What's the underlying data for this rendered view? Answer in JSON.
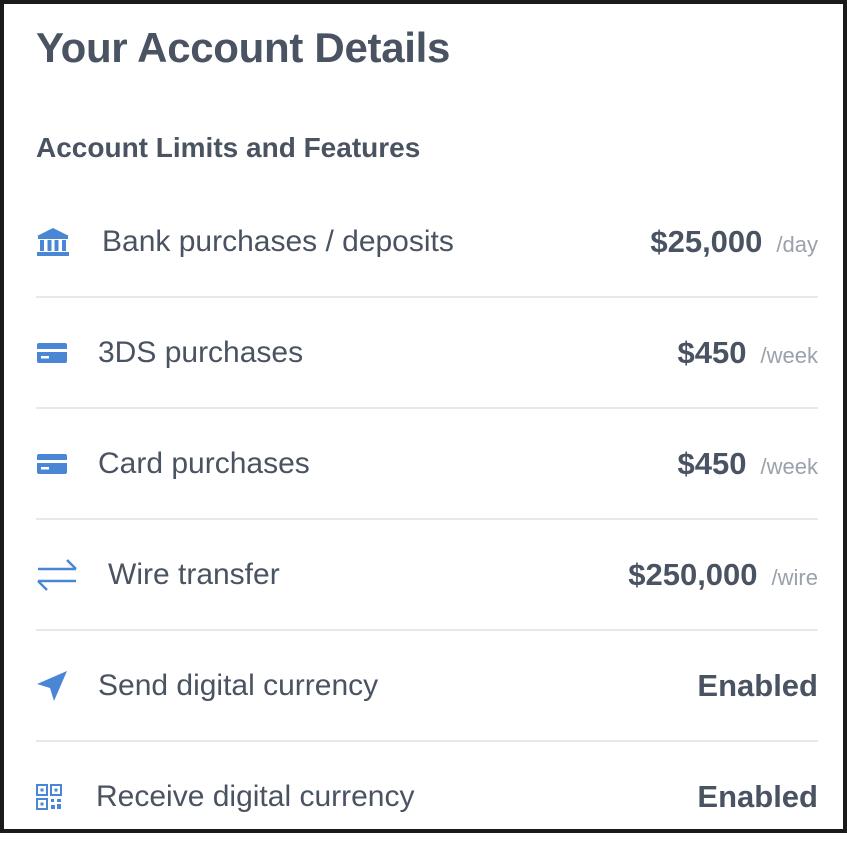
{
  "header": {
    "title": "Your Account Details",
    "section_title": "Account Limits and Features"
  },
  "colors": {
    "icon_blue": "#4a86d6",
    "text_dark": "#4a5362",
    "text_muted": "#9aa1ab",
    "divider": "#e6e8ec"
  },
  "limits": [
    {
      "icon": "bank-icon",
      "label": "Bank purchases / deposits",
      "amount": "$25,000",
      "unit": "/day"
    },
    {
      "icon": "credit-card-icon",
      "label": "3DS purchases",
      "amount": "$450",
      "unit": "/week"
    },
    {
      "icon": "credit-card-icon",
      "label": "Card purchases",
      "amount": "$450",
      "unit": "/week"
    },
    {
      "icon": "transfer-arrows-icon",
      "label": "Wire transfer",
      "amount": "$250,000",
      "unit": "/wire"
    }
  ],
  "features": [
    {
      "icon": "paper-plane-icon",
      "label": "Send digital currency",
      "status": "Enabled"
    },
    {
      "icon": "qr-code-icon",
      "label": "Receive digital currency",
      "status": "Enabled"
    }
  ]
}
